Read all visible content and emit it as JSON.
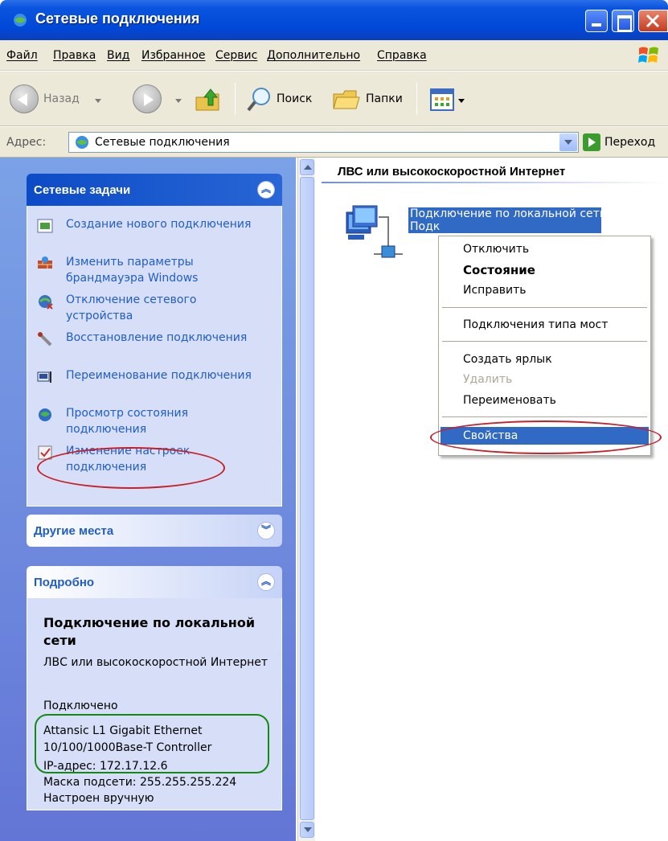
{
  "window": {
    "title": "Сетевые подключения"
  },
  "menu": [
    "Файл",
    "Правка",
    "Вид",
    "Избранное",
    "Сервис",
    "Дополнительно",
    "Справка"
  ],
  "toolbar": {
    "back": "Назад",
    "search": "Поиск",
    "folders": "Папки"
  },
  "address": {
    "label": "Адрес:",
    "value": "Сетевые подключения",
    "go": "Переход"
  },
  "network_tasks": {
    "title": "Сетевые задачи",
    "items": [
      {
        "label": "Создание нового подключения",
        "icon": "new-connection-icon"
      },
      {
        "label": "Изменить параметры брандмауэра Windows",
        "icon": "firewall-icon"
      },
      {
        "label": "Отключение сетевого устройства",
        "icon": "disable-network-icon"
      },
      {
        "label": "Восстановление подключения",
        "icon": "repair-icon"
      },
      {
        "label": "Переименование подключения",
        "icon": "rename-icon"
      },
      {
        "label": "Просмотр состояния подключения",
        "icon": "status-icon"
      },
      {
        "label": "Изменение настроек подключения",
        "icon": "properties-icon"
      }
    ]
  },
  "other_places": {
    "title": "Другие места"
  },
  "details": {
    "title": "Подробно",
    "name": "Подключение по локальной сети",
    "type": "ЛВС или высокоскоростной Интернет",
    "status": "Подключено",
    "adapter": "Attansic L1 Gigabit Ethernet 10/100/1000Base-T Controller",
    "ip": "IP-адрес: 172.17.12.6",
    "mask": "Маска подсети: 255.255.255.224",
    "config": "Настроен вручную"
  },
  "content": {
    "group": "ЛВС или высокоскоростной Интернет",
    "connection_label": "Подключение по локальной сети\nПодк"
  },
  "context_menu": {
    "disable": "Отключить",
    "status": "Состояние",
    "repair": "Исправить",
    "bridge": "Подключения типа мост",
    "shortcut": "Создать ярлык",
    "delete": "Удалить",
    "rename": "Переименовать",
    "properties": "Свойства"
  },
  "colors": {
    "title_bar": "#0048d8",
    "task_pane": "#7ba2e7",
    "selection": "#316ac5",
    "annotation_red": "#c8202a",
    "annotation_green": "#148a14"
  }
}
